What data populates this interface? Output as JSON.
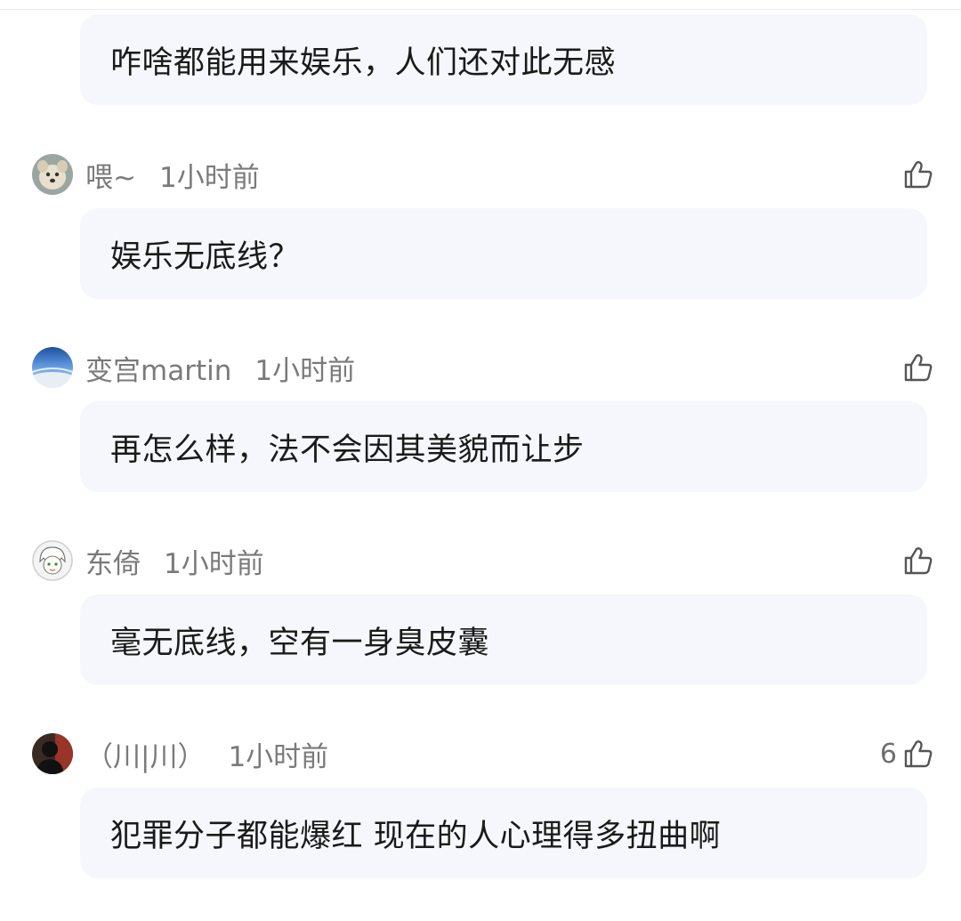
{
  "comments": [
    {
      "author": "",
      "time": "",
      "likes": "",
      "text": "咋啥都能用来娱乐，人们还对此无感"
    },
    {
      "author": "喂~",
      "time": "1小时前",
      "likes": "",
      "avatar_icon": "dog-avatar-icon",
      "text": "娱乐无底线？"
    },
    {
      "author": "变宫martin",
      "time": "1小时前",
      "likes": "",
      "avatar_icon": "earth-sky-avatar-icon",
      "text": "再怎么样，法不会因其美貌而让步"
    },
    {
      "author": "东倚",
      "time": "1小时前",
      "likes": "",
      "avatar_icon": "anime-character-avatar-icon",
      "text": "毫无底线，空有一身臭皮囊"
    },
    {
      "author": "（川|川）",
      "time": "1小时前",
      "likes": "6",
      "avatar_icon": "person-silhouette-avatar-icon",
      "text": "犯罪分子都能爆红 现在的人心理得多扭曲啊"
    }
  ],
  "icons": {
    "like": "thumbs-up-icon"
  },
  "colors": {
    "bubble_bg": "#f5f7fc",
    "meta_text": "#7a7a7a",
    "body_text": "#1a1a1a"
  }
}
